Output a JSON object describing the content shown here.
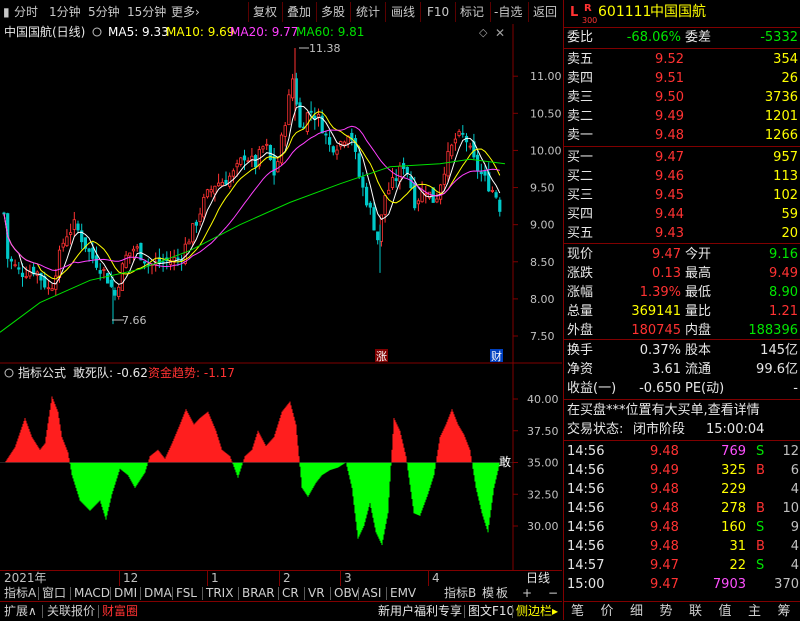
{
  "toolbar": {
    "left_items": [
      "分时",
      "1分钟",
      "5分钟",
      "15分钟",
      "更多"
    ],
    "more_caret": "›",
    "right_items": [
      "复权",
      "叠加",
      "多股",
      "统计",
      "画线",
      "F10",
      "标记",
      "-自选",
      "返回"
    ]
  },
  "main_chart": {
    "stock_title": "中国国航(日线)",
    "ma_labels": [
      {
        "label": "MA5: 9.33",
        "color": "#ffffff"
      },
      {
        "label": "MA10: 9.69",
        "color": "#ffff00"
      },
      {
        "label": "MA20: 9.77",
        "color": "#ff40ff"
      },
      {
        "label": "MA60: 9.81",
        "color": "#00e000"
      }
    ],
    "high_annotation": "11.38",
    "low_annotation": "7.66",
    "badge_up": "涨",
    "badge_fin": "财",
    "y_ticks": [
      "11.00",
      "10.50",
      "10.00",
      "9.50",
      "9.00",
      "8.50",
      "8.00",
      "7.50"
    ]
  },
  "indicator": {
    "label": "指标公式",
    "name": "敢死队: -0.62",
    "sub": "资金趋势: -1.17",
    "y_ticks": [
      "40.00",
      "37.50",
      "35.00",
      "32.50",
      "30.00"
    ],
    "right_mark": "敢"
  },
  "x_axis": {
    "labels": [
      "2021年",
      "12",
      "1",
      "2",
      "3",
      "4"
    ],
    "right_label": "日线"
  },
  "indicator_tabs": [
    "指标A",
    "窗口",
    "MACD",
    "DMI",
    "DMA",
    "FSL",
    "TRIX",
    "BRAR",
    "CR",
    "VR",
    "OBV",
    "ASI",
    "EMV"
  ],
  "indicator_tabs_right": [
    "指标B",
    "模",
    "板",
    "+",
    "−"
  ],
  "bottom_tabs": [
    "扩展∧",
    "关联报价",
    "财富圈"
  ],
  "bottom_right_tabs": [
    "新用户福利专享",
    "图文F10",
    "侧边栏"
  ],
  "quote": {
    "badge_l": "L",
    "badge_r": "R",
    "badge_num": "300",
    "code": "601111",
    "name": "中国国航",
    "weibi_label": "委比",
    "weibi": "-68.06%",
    "weicha_label": "委差",
    "weicha": "-5332",
    "asks": [
      {
        "label": "卖五",
        "price": "9.52",
        "vol": "354"
      },
      {
        "label": "卖四",
        "price": "9.51",
        "vol": "26"
      },
      {
        "label": "卖三",
        "price": "9.50",
        "vol": "3736"
      },
      {
        "label": "卖二",
        "price": "9.49",
        "vol": "1201"
      },
      {
        "label": "卖一",
        "price": "9.48",
        "vol": "1266"
      }
    ],
    "bids": [
      {
        "label": "买一",
        "price": "9.47",
        "vol": "957"
      },
      {
        "label": "买二",
        "price": "9.46",
        "vol": "113"
      },
      {
        "label": "买三",
        "price": "9.45",
        "vol": "102"
      },
      {
        "label": "买四",
        "price": "9.44",
        "vol": "59"
      },
      {
        "label": "买五",
        "price": "9.43",
        "vol": "20"
      }
    ],
    "stats": [
      {
        "l1": "现价",
        "v1": "9.47",
        "c1": "red",
        "l2": "今开",
        "v2": "9.16",
        "c2": "grn"
      },
      {
        "l1": "涨跌",
        "v1": "0.13",
        "c1": "red",
        "l2": "最高",
        "v2": "9.49",
        "c2": "red"
      },
      {
        "l1": "涨幅",
        "v1": "1.39%",
        "c1": "red",
        "l2": "最低",
        "v2": "8.90",
        "c2": "grn"
      },
      {
        "l1": "总量",
        "v1": "369141",
        "c1": "yel",
        "l2": "量比",
        "v2": "1.21",
        "c2": "red"
      },
      {
        "l1": "外盘",
        "v1": "180745",
        "c1": "red",
        "l2": "内盘",
        "v2": "188396",
        "c2": "grn"
      }
    ],
    "stats2": [
      {
        "l1": "换手",
        "v1": "0.37%",
        "l2": "股本",
        "v2": "145亿"
      },
      {
        "l1": "净资",
        "v1": "3.61",
        "l2": "流通",
        "v2": "99.6亿"
      },
      {
        "l1": "收益(一)",
        "v1": "-0.650",
        "l2": "PE(动)",
        "v2": "-"
      }
    ],
    "notice": "在买盘***位置有大买单,查看详情",
    "status_label": "交易状态:",
    "status": "闭市阶段",
    "status_time": "15:00:04",
    "ticks": [
      {
        "t": "14:56",
        "p": "9.48",
        "v": "769",
        "vc": "mag",
        "s": "S",
        "sc": "grn",
        "n": "12"
      },
      {
        "t": "14:56",
        "p": "9.49",
        "v": "325",
        "vc": "yel",
        "s": "B",
        "sc": "red",
        "n": "6"
      },
      {
        "t": "14:56",
        "p": "9.48",
        "v": "229",
        "vc": "yel",
        "s": "",
        "sc": "gry",
        "n": "4"
      },
      {
        "t": "14:56",
        "p": "9.48",
        "v": "278",
        "vc": "yel",
        "s": "B",
        "sc": "red",
        "n": "10"
      },
      {
        "t": "14:56",
        "p": "9.48",
        "v": "160",
        "vc": "yel",
        "s": "S",
        "sc": "grn",
        "n": "9"
      },
      {
        "t": "14:56",
        "p": "9.48",
        "v": "31",
        "vc": "yel",
        "s": "B",
        "sc": "red",
        "n": "4"
      },
      {
        "t": "14:57",
        "p": "9.47",
        "v": "22",
        "vc": "yel",
        "s": "S",
        "sc": "grn",
        "n": "4"
      },
      {
        "t": "15:00",
        "p": "9.47",
        "v": "7903",
        "vc": "mag",
        "s": "",
        "sc": "gry",
        "n": "370"
      }
    ]
  },
  "right_tabs": [
    "笔",
    "价",
    "细",
    "势",
    "联",
    "值",
    "主",
    "筹"
  ],
  "colors": {
    "up": "#ff3232",
    "down": "#00e600",
    "border": "#800000",
    "price": "#ffff00"
  }
}
